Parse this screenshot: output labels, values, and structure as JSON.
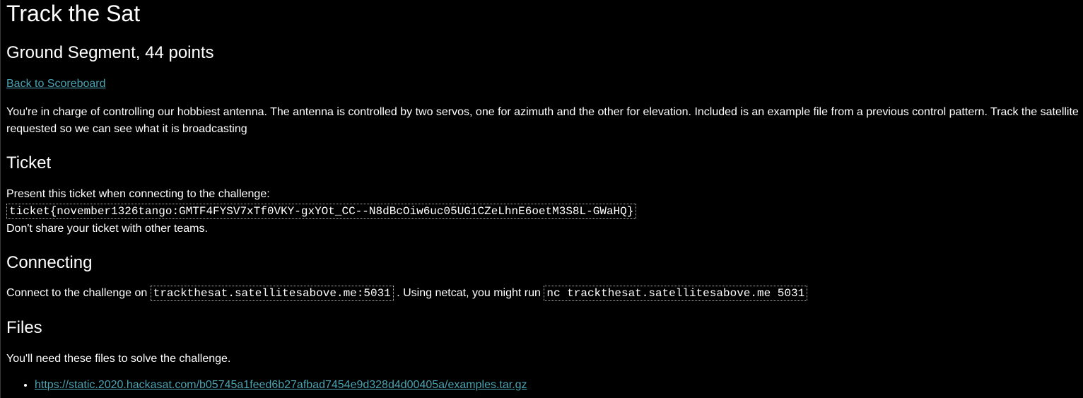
{
  "title": "Track the Sat",
  "subtitle": "Ground Segment, 44 points",
  "back_link": "Back to Scoreboard",
  "description": "You're in charge of controlling our hobbiest antenna. The antenna is controlled by two servos, one for azimuth and the other for elevation. Included is an example file from a previous control pattern. Track the satellite requested so we can see what it is broadcasting",
  "ticket": {
    "heading": "Ticket",
    "intro": "Present this ticket when connecting to the challenge:",
    "value": "ticket{november1326tango:GMTF4FYSV7xTf0VKY-gxYOt_CC--N8dBcOiw6uc05UG1CZeLhnE6oetM3S8L-GWaHQ}",
    "note": "Don't share your ticket with other teams."
  },
  "connecting": {
    "heading": "Connecting",
    "prefix": "Connect to the challenge on",
    "host": "trackthesat.satellitesabove.me:5031",
    "middle": ". Using netcat, you might run",
    "command": "nc trackthesat.satellitesabove.me 5031"
  },
  "files": {
    "heading": "Files",
    "intro": "You'll need these files to solve the challenge.",
    "items": [
      {
        "url": "https://static.2020.hackasat.com/b05745a1feed6b27afbad7454e9d328d4d00405a/examples.tar.gz"
      }
    ]
  },
  "colors": {
    "background": "#000000",
    "text": "#ffffff",
    "link": "#4aa3b3"
  }
}
